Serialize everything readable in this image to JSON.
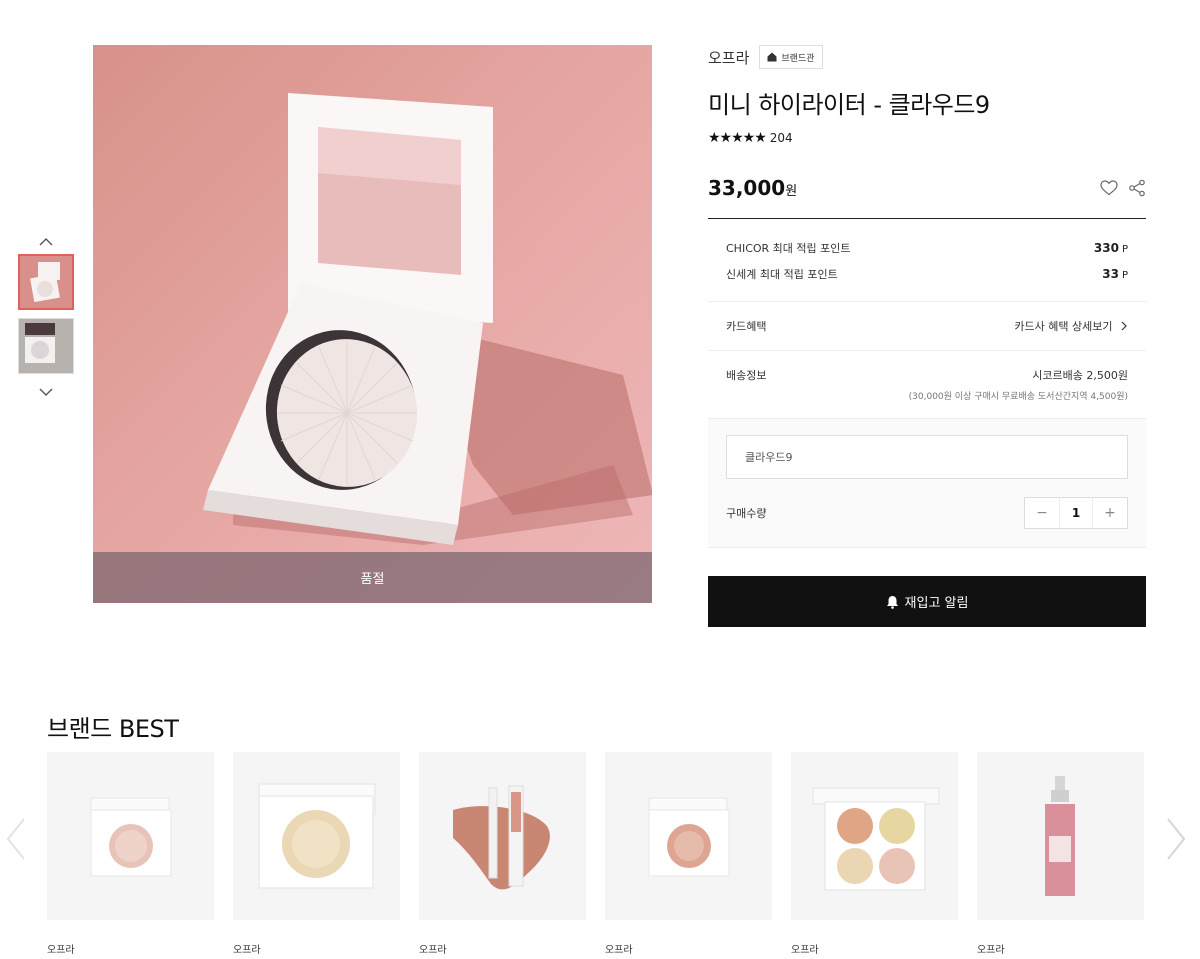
{
  "gallery": {
    "up_icon": "chevron-up-icon",
    "down_icon": "chevron-down-icon",
    "soldout_label": "품절"
  },
  "product": {
    "brand": "오프라",
    "brand_shop_label": "브랜드관",
    "title": "미니 하이라이터 - 클라우드9",
    "stars": "★★★★★",
    "review_count": "204",
    "price": "33,000",
    "currency": "원"
  },
  "points": [
    {
      "label": "CHICOR 최대 적립 포인트",
      "value": "330",
      "unit": "P"
    },
    {
      "label": "신세계 최대 적립 포인트",
      "value": "33",
      "unit": "P"
    }
  ],
  "card_benefit": {
    "label": "카드혜택",
    "link": "카드사 혜택 상세보기"
  },
  "shipping": {
    "label": "배송정보",
    "value": "시코르배송 2,500원",
    "note": "(30,000원 이상 구매시 무료배송 도서산간지역 4,500원)"
  },
  "option": {
    "selected": "클라우드9",
    "qty_label": "구매수량",
    "minus": "−",
    "qty": "1",
    "plus": "+"
  },
  "restock_button": "재입고 알림",
  "best": {
    "title": "브랜드 BEST",
    "items": [
      {
        "brand": "오프라"
      },
      {
        "brand": "오프라"
      },
      {
        "brand": "오프라"
      },
      {
        "brand": "오프라"
      },
      {
        "brand": "오프라"
      },
      {
        "brand": "오프라"
      }
    ]
  }
}
